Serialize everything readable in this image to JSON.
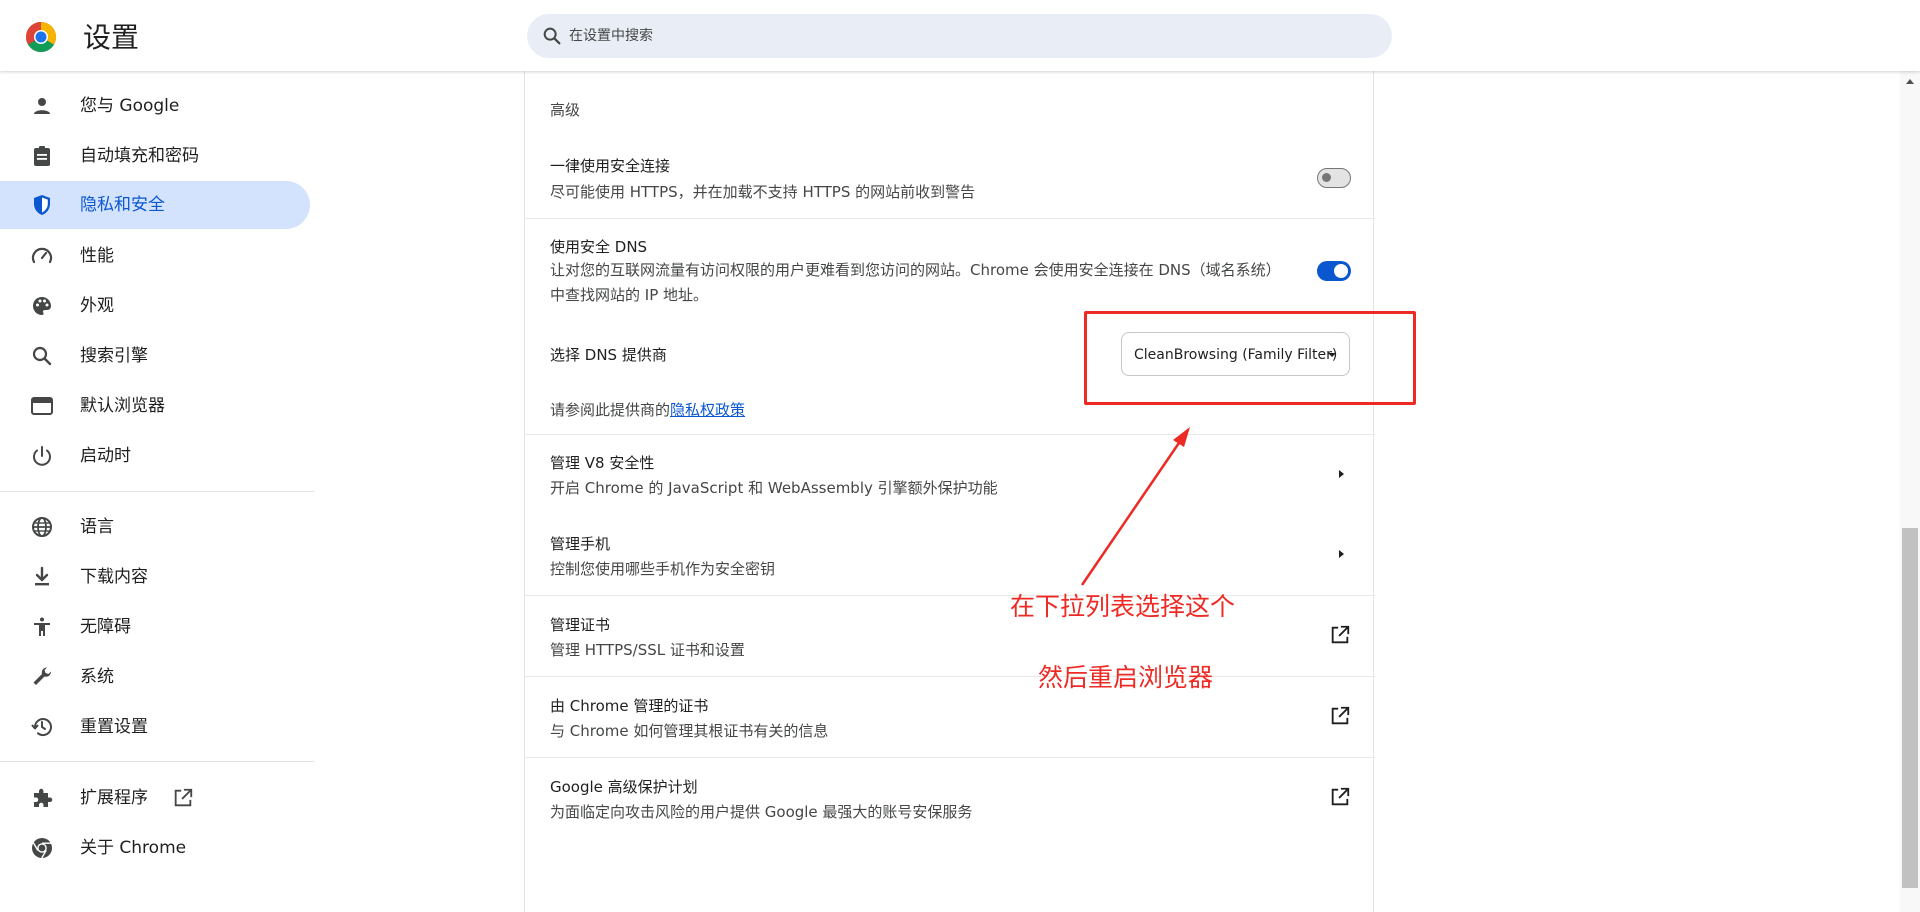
{
  "header": {
    "title": "设置",
    "search_placeholder": "在设置中搜索"
  },
  "sidebar": {
    "items": [
      {
        "label": "您与 Google",
        "icon": "person-icon"
      },
      {
        "label": "自动填充和密码",
        "icon": "clipboard-icon"
      },
      {
        "label": "隐私和安全",
        "icon": "shield-icon",
        "active": true
      },
      {
        "label": "性能",
        "icon": "speedometer-icon"
      },
      {
        "label": "外观",
        "icon": "palette-icon"
      },
      {
        "label": "搜索引擎",
        "icon": "search-icon"
      },
      {
        "label": "默认浏览器",
        "icon": "browser-window-icon"
      },
      {
        "label": "启动时",
        "icon": "power-icon"
      },
      {
        "label": "语言",
        "icon": "globe-icon"
      },
      {
        "label": "下载内容",
        "icon": "download-icon"
      },
      {
        "label": "无障碍",
        "icon": "accessibility-icon"
      },
      {
        "label": "系统",
        "icon": "wrench-icon"
      },
      {
        "label": "重置设置",
        "icon": "history-icon"
      },
      {
        "label": "扩展程序",
        "icon": "puzzle-icon"
      },
      {
        "label": "关于 Chrome",
        "icon": "chrome-icon"
      }
    ]
  },
  "main": {
    "section_title": "高级",
    "https_only": {
      "title": "一律使用安全连接",
      "desc": "尽可能使用 HTTPS，并在加载不支持 HTTPS 的网站前收到警告",
      "enabled": false
    },
    "secure_dns": {
      "title": "使用安全 DNS",
      "desc": "让对您的互联网流量有访问权限的用户更难看到您访问的网站。Chrome 会使用安全连接在 DNS（域名系统）中查找网站的 IP 地址。",
      "enabled": true
    },
    "dns_provider": {
      "label": "选择 DNS 提供商",
      "selected": "CleanBrowsing (Family Filter)",
      "policy_prefix": "请参阅此提供商的",
      "policy_link": "隐私权政策"
    },
    "v8_security": {
      "title": "管理 V8 安全性",
      "desc": "开启 Chrome 的 JavaScript 和 WebAssembly 引擎额外保护功能"
    },
    "phones": {
      "title": "管理手机",
      "desc": "控制您使用哪些手机作为安全密钥"
    },
    "certificates": {
      "title": "管理证书",
      "desc": "管理 HTTPS/SSL 证书和设置"
    },
    "chrome_certs": {
      "title": "由 Chrome 管理的证书",
      "desc": "与 Chrome 如何管理其根证书有关的信息"
    },
    "advanced_protection": {
      "title": "Google 高级保护计划",
      "desc": "为面临定向攻击风险的用户提供 Google 最强大的账号安保服务"
    }
  },
  "annotation": {
    "line1": "在下拉列表选择这个",
    "line2": "然后重启浏览器",
    "color": "#ee2a24"
  },
  "colors": {
    "accent": "#0b57d0",
    "active_nav_bg": "#d3e3fd",
    "search_bg": "#e9eef6"
  }
}
